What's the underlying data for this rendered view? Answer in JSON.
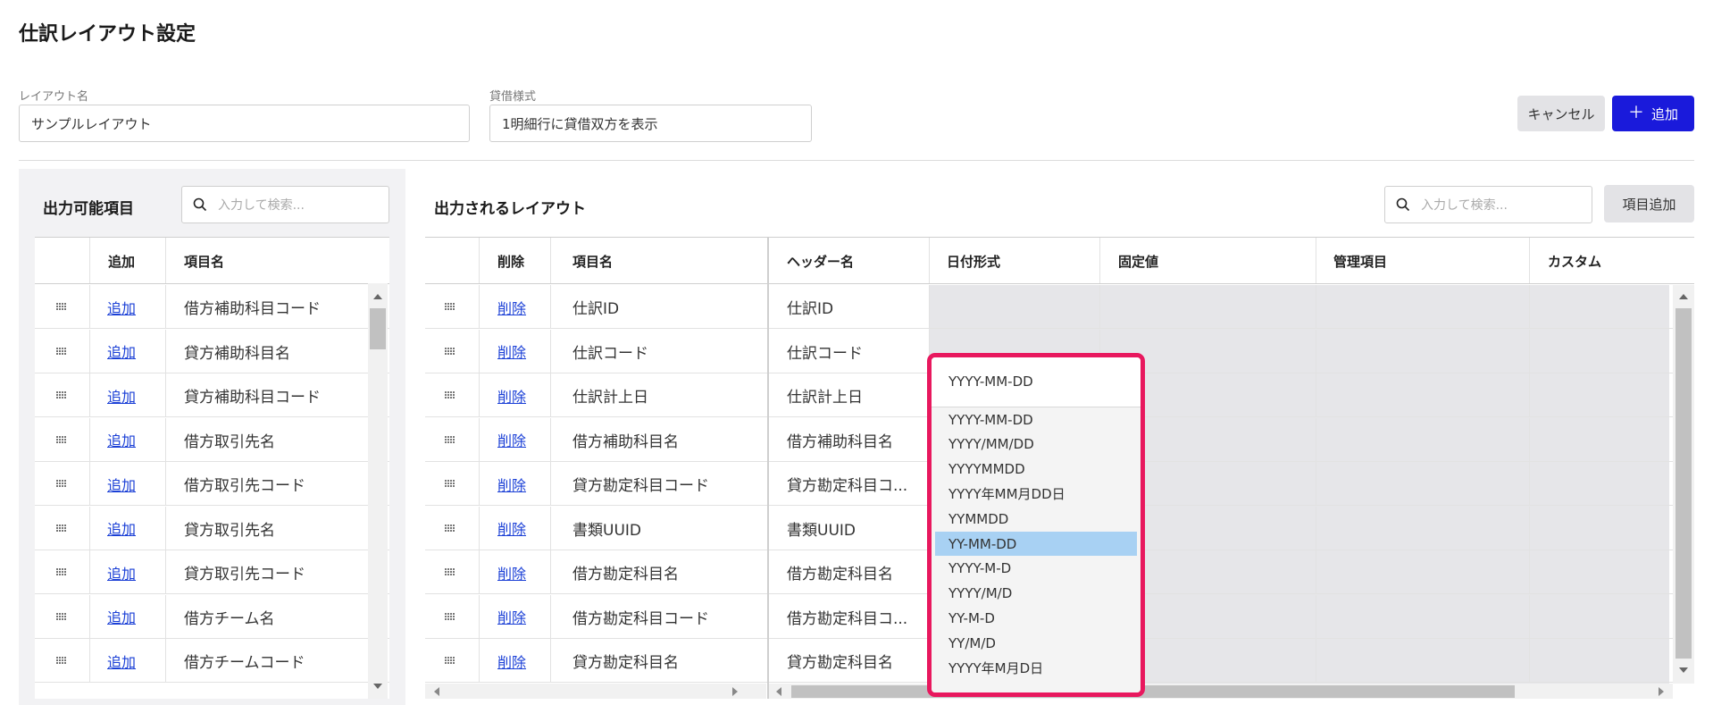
{
  "page": {
    "title": "仕訳レイアウト設定"
  },
  "form": {
    "layout_name_label": "レイアウト名",
    "layout_name_value": "サンプルレイアウト",
    "style_label": "貸借様式",
    "style_value": "1明細行に貸借双方を表示"
  },
  "actions": {
    "cancel_label": "キャンセル",
    "add_label": "追加",
    "add_icon": "plus-icon"
  },
  "left": {
    "title": "出力可能項目",
    "search_placeholder": "入力して検索...",
    "columns": [
      "追加",
      "項目名"
    ],
    "rows": [
      {
        "action": "追加",
        "name": "借方補助科目コード"
      },
      {
        "action": "追加",
        "name": "貸方補助科目名"
      },
      {
        "action": "追加",
        "name": "貸方補助科目コード"
      },
      {
        "action": "追加",
        "name": "借方取引先名"
      },
      {
        "action": "追加",
        "name": "借方取引先コード"
      },
      {
        "action": "追加",
        "name": "貸方取引先名"
      },
      {
        "action": "追加",
        "name": "貸方取引先コード"
      },
      {
        "action": "追加",
        "name": "借方チーム名"
      },
      {
        "action": "追加",
        "name": "借方チームコード"
      }
    ]
  },
  "right": {
    "title": "出力されるレイアウト",
    "search_placeholder": "入力して検索...",
    "add_item_label": "項目追加",
    "columns": [
      "削除",
      "項目名",
      "ヘッダー名",
      "日付形式",
      "固定値",
      "管理項目",
      "カスタム"
    ],
    "rows": [
      {
        "action": "削除",
        "name": "仕訳ID",
        "header": "仕訳ID"
      },
      {
        "action": "削除",
        "name": "仕訳コード",
        "header": "仕訳コード"
      },
      {
        "action": "削除",
        "name": "仕訳計上日",
        "header": "仕訳計上日"
      },
      {
        "action": "削除",
        "name": "借方補助科目名",
        "header": "借方補助科目名"
      },
      {
        "action": "削除",
        "name": "貸方勘定科目コード",
        "header": "貸方勘定科目コ..."
      },
      {
        "action": "削除",
        "name": "書類UUID",
        "header": "書類UUID"
      },
      {
        "action": "削除",
        "name": "借方勘定科目名",
        "header": "借方勘定科目名"
      },
      {
        "action": "削除",
        "name": "借方勘定科目コード",
        "header": "借方勘定科目コ..."
      },
      {
        "action": "削除",
        "name": "貸方勘定科目名",
        "header": "貸方勘定科目名"
      }
    ]
  },
  "date_dropdown": {
    "selected": "YYYY-MM-DD",
    "highlighted": "YY-MM-DD",
    "options": [
      "YYYY-MM-DD",
      "YYYY/MM/DD",
      "YYYYMMDD",
      "YYYY年MM月DD日",
      "YYMMDD",
      "YY-MM-DD",
      "YYYY-M-D",
      "YYYY/M/D",
      "YY-M-D",
      "YY/M/D",
      "YYYY年M月D日"
    ],
    "highlight_color": "#a8d1f3",
    "border_color": "#e8185e"
  },
  "colors": {
    "primary": "#1a1adb",
    "link": "#1a3fd6"
  }
}
